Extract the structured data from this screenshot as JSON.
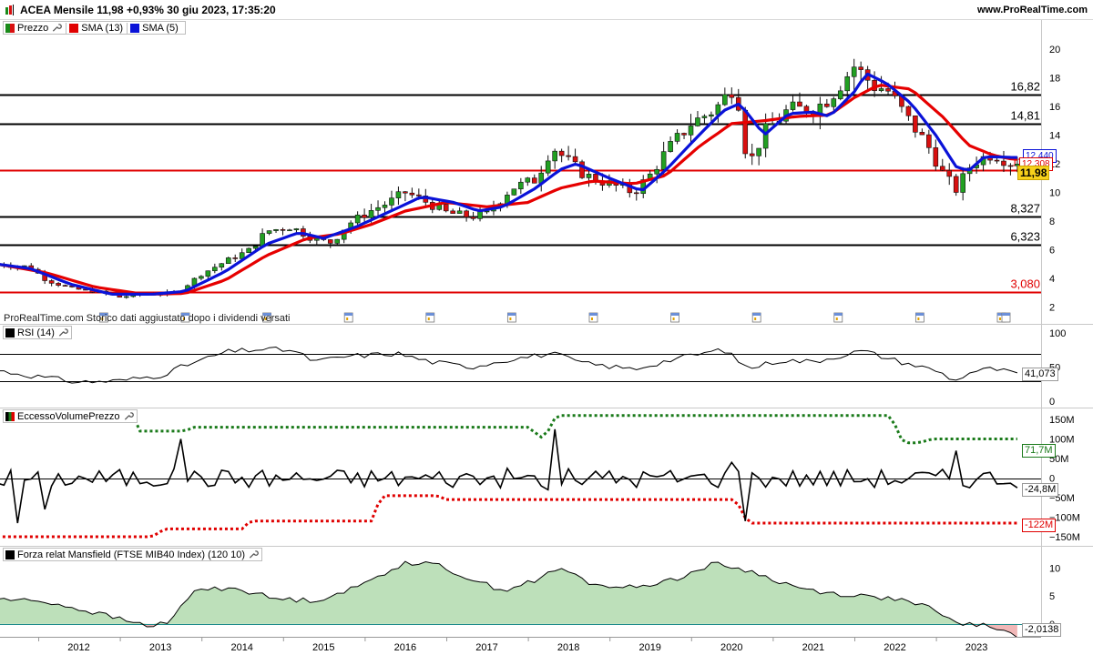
{
  "header": {
    "title": "ACEA Mensile 11,98 +0,93% 30 giu 2023, 17:35:20",
    "site": "www.ProRealTime.com"
  },
  "legend_price": [
    {
      "label": "Prezzo",
      "color": "#1a8a1a"
    },
    {
      "label": "SMA (13)",
      "color": "#e00000"
    },
    {
      "label": "SMA (5)",
      "color": "#0a12d8"
    }
  ],
  "legend_rsi": {
    "label": "RSI (14)"
  },
  "legend_volume": {
    "label": "EccessoVolumePrezzo"
  },
  "legend_mansfield": {
    "label": "Forza relat Mansfield (FTSE MIB40 Index) (120 10)"
  },
  "watermark": "ProRealTime.com  Storico dati aggiustato dopo i dividendi versati",
  "badges": {
    "price_last": "11,98",
    "sma13_last": "12,308",
    "sma5_last": "12,440",
    "rsi_last": "41,073",
    "vol_upper_last": "71,7M",
    "vol_main_last": "-24,8M",
    "vol_lower_last": "-122M",
    "mansfield_last": "-2,0138"
  },
  "colors": {
    "bull": "#22a022",
    "bear": "#d81010",
    "sma13": "#e60000",
    "sma5": "#0a12d8",
    "level_black": "#000000",
    "level_red": "#e00000",
    "vol_green": "#1a7a1a",
    "vol_red": "#e00000",
    "mansfield_fill": "#b6ddb2",
    "mansfield_neg_fill": "#f0b7b7"
  },
  "icons": {
    "logo": "prorealtime-logo-icon",
    "settings": "wrench-icon",
    "dividend": "dividend-calendar-icon"
  },
  "chart_data": [
    {
      "type": "candlestick",
      "name": "price",
      "x_axis_years": [
        "2012",
        "2013",
        "2014",
        "2015",
        "2016",
        "2017",
        "2018",
        "2019",
        "2020",
        "2021",
        "2022",
        "2023"
      ],
      "x_range": [
        2011.0,
        2023.5
      ],
      "ylim": [
        2,
        21
      ],
      "y_ticks": [
        2,
        4,
        6,
        8,
        10,
        12,
        14,
        16,
        18,
        20
      ],
      "price_anchors": [
        [
          2011.0,
          5.0
        ],
        [
          2011.4,
          4.8
        ],
        [
          2011.6,
          3.9
        ],
        [
          2011.9,
          3.3
        ],
        [
          2012.2,
          3.1
        ],
        [
          2012.5,
          2.7
        ],
        [
          2012.8,
          2.9
        ],
        [
          2013.2,
          3.0
        ],
        [
          2013.5,
          4.3
        ],
        [
          2013.8,
          5.2
        ],
        [
          2014.1,
          6.0
        ],
        [
          2014.3,
          7.3
        ],
        [
          2014.6,
          7.6
        ],
        [
          2014.9,
          6.7
        ],
        [
          2015.1,
          6.5
        ],
        [
          2015.3,
          7.8
        ],
        [
          2015.6,
          8.8
        ],
        [
          2015.8,
          9.3
        ],
        [
          2016.0,
          10.0
        ],
        [
          2016.2,
          9.5
        ],
        [
          2016.5,
          8.6
        ],
        [
          2016.8,
          8.3
        ],
        [
          2017.0,
          8.5
        ],
        [
          2017.3,
          10.3
        ],
        [
          2017.6,
          10.9
        ],
        [
          2017.8,
          13.2
        ],
        [
          2017.95,
          12.4
        ],
        [
          2018.2,
          11.2
        ],
        [
          2018.5,
          10.6
        ],
        [
          2018.8,
          10.0
        ],
        [
          2019.0,
          11.2
        ],
        [
          2019.2,
          12.9
        ],
        [
          2019.5,
          14.8
        ],
        [
          2019.8,
          15.8
        ],
        [
          2020.05,
          17.6
        ],
        [
          2020.2,
          11.8
        ],
        [
          2020.4,
          14.2
        ],
        [
          2020.7,
          15.8
        ],
        [
          2021.0,
          15.8
        ],
        [
          2021.2,
          16.6
        ],
        [
          2021.5,
          18.8
        ],
        [
          2021.75,
          17.4
        ],
        [
          2021.9,
          17.2
        ],
        [
          2022.2,
          14.8
        ],
        [
          2022.4,
          13.3
        ],
        [
          2022.6,
          11.2
        ],
        [
          2022.75,
          10.2
        ],
        [
          2022.95,
          12.1
        ],
        [
          2023.2,
          12.7
        ],
        [
          2023.45,
          11.98
        ]
      ],
      "lines": [
        {
          "name": "SMA (13)",
          "anchors": [
            [
              2011.0,
              5.0
            ],
            [
              2011.6,
              4.4
            ],
            [
              2012.2,
              3.4
            ],
            [
              2012.8,
              2.9
            ],
            [
              2013.3,
              2.95
            ],
            [
              2013.8,
              3.9
            ],
            [
              2014.3,
              5.6
            ],
            [
              2014.8,
              6.8
            ],
            [
              2015.2,
              7.1
            ],
            [
              2015.6,
              7.8
            ],
            [
              2016.0,
              8.7
            ],
            [
              2016.5,
              9.3
            ],
            [
              2017.0,
              9.0
            ],
            [
              2017.5,
              9.3
            ],
            [
              2017.9,
              10.3
            ],
            [
              2018.3,
              10.8
            ],
            [
              2018.8,
              10.6
            ],
            [
              2019.2,
              11.2
            ],
            [
              2019.6,
              13.2
            ],
            [
              2020.0,
              14.8
            ],
            [
              2020.4,
              15.0
            ],
            [
              2020.8,
              15.3
            ],
            [
              2021.2,
              15.4
            ],
            [
              2021.5,
              16.6
            ],
            [
              2021.8,
              17.5
            ],
            [
              2022.2,
              17.2
            ],
            [
              2022.6,
              15.2
            ],
            [
              2022.9,
              13.3
            ],
            [
              2023.2,
              12.6
            ],
            [
              2023.45,
              12.31
            ]
          ]
        },
        {
          "name": "SMA (5)",
          "anchors": [
            [
              2011.0,
              5.0
            ],
            [
              2011.4,
              4.7
            ],
            [
              2011.9,
              3.6
            ],
            [
              2012.4,
              2.9
            ],
            [
              2012.9,
              2.9
            ],
            [
              2013.3,
              3.1
            ],
            [
              2013.8,
              4.5
            ],
            [
              2014.3,
              6.4
            ],
            [
              2014.7,
              7.2
            ],
            [
              2015.0,
              6.8
            ],
            [
              2015.4,
              7.6
            ],
            [
              2015.9,
              8.9
            ],
            [
              2016.2,
              9.7
            ],
            [
              2016.6,
              9.3
            ],
            [
              2016.9,
              8.7
            ],
            [
              2017.2,
              9.0
            ],
            [
              2017.6,
              10.3
            ],
            [
              2017.9,
              11.6
            ],
            [
              2018.1,
              12.0
            ],
            [
              2018.5,
              11.0
            ],
            [
              2018.9,
              10.1
            ],
            [
              2019.2,
              11.6
            ],
            [
              2019.6,
              14.0
            ],
            [
              2019.9,
              15.7
            ],
            [
              2020.1,
              16.2
            ],
            [
              2020.4,
              14.0
            ],
            [
              2020.7,
              15.5
            ],
            [
              2021.0,
              15.6
            ],
            [
              2021.2,
              15.3
            ],
            [
              2021.5,
              17.0
            ],
            [
              2021.65,
              18.3
            ],
            [
              2021.9,
              17.6
            ],
            [
              2022.2,
              16.2
            ],
            [
              2022.5,
              14.0
            ],
            [
              2022.75,
              11.8
            ],
            [
              2022.9,
              11.5
            ],
            [
              2023.1,
              12.5
            ],
            [
              2023.45,
              12.44
            ]
          ]
        }
      ],
      "levels": [
        {
          "value": 16.82,
          "label": "16,82",
          "color": "black"
        },
        {
          "value": 14.81,
          "label": "14,81",
          "color": "black"
        },
        {
          "value": 11.57,
          "label": "11,57",
          "color": "red"
        },
        {
          "value": 8.327,
          "label": "8,327",
          "color": "black"
        },
        {
          "value": 6.323,
          "label": "6,323",
          "color": "black"
        },
        {
          "value": 3.08,
          "label": "3,080",
          "color": "red"
        }
      ]
    },
    {
      "type": "line",
      "name": "RSI (14)",
      "ylim": [
        0,
        100
      ],
      "y_ticks": [
        0,
        50,
        100
      ],
      "bands": [
        30,
        70
      ],
      "anchors": [
        [
          2011.0,
          45
        ],
        [
          2011.5,
          36
        ],
        [
          2012.0,
          28
        ],
        [
          2012.5,
          30
        ],
        [
          2013.0,
          38
        ],
        [
          2013.3,
          52
        ],
        [
          2013.8,
          72
        ],
        [
          2014.2,
          76
        ],
        [
          2014.6,
          75
        ],
        [
          2014.9,
          58
        ],
        [
          2015.3,
          66
        ],
        [
          2015.9,
          70
        ],
        [
          2016.3,
          58
        ],
        [
          2016.8,
          50
        ],
        [
          2017.2,
          60
        ],
        [
          2017.8,
          70
        ],
        [
          2018.2,
          55
        ],
        [
          2018.8,
          47
        ],
        [
          2019.3,
          62
        ],
        [
          2019.9,
          76
        ],
        [
          2020.2,
          48
        ],
        [
          2020.6,
          60
        ],
        [
          2021.0,
          58
        ],
        [
          2021.6,
          74
        ],
        [
          2022.0,
          60
        ],
        [
          2022.5,
          45
        ],
        [
          2022.75,
          30
        ],
        [
          2022.9,
          42
        ],
        [
          2023.2,
          48
        ],
        [
          2023.45,
          41
        ]
      ]
    },
    {
      "type": "line",
      "name": "EccessoVolumePrezzo",
      "ylim": [
        -150,
        150
      ],
      "y_ticks": [
        150,
        100,
        50,
        0,
        -50,
        -100,
        -150
      ],
      "y_tick_labels": [
        "150M",
        "100M",
        "50M",
        "0",
        "-50M",
        "-100M",
        "-150M"
      ],
      "upper_band_steps": [
        [
          2011.0,
          190
        ],
        [
          2012.6,
          190
        ],
        [
          2012.75,
          120
        ],
        [
          2013.3,
          120
        ],
        [
          2013.4,
          130
        ],
        [
          2017.5,
          130
        ],
        [
          2017.7,
          100
        ],
        [
          2017.85,
          160
        ],
        [
          2021.95,
          160
        ],
        [
          2022.1,
          90
        ],
        [
          2022.3,
          90
        ],
        [
          2022.45,
          100
        ],
        [
          2023.45,
          100
        ]
      ],
      "lower_band_steps": [
        [
          2011.0,
          -150
        ],
        [
          2012.9,
          -150
        ],
        [
          2013.05,
          -130
        ],
        [
          2014.0,
          -130
        ],
        [
          2014.1,
          -110
        ],
        [
          2015.6,
          -110
        ],
        [
          2015.7,
          -45
        ],
        [
          2016.4,
          -45
        ],
        [
          2016.5,
          -55
        ],
        [
          2020.05,
          -55
        ],
        [
          2020.2,
          -115
        ],
        [
          2023.45,
          -115
        ]
      ]
    },
    {
      "type": "area",
      "name": "Forza relat Mansfield (FTSE MIB40 Index) (120 10)",
      "ylim": [
        -2.5,
        12
      ],
      "y_ticks": [
        10,
        5,
        0
      ],
      "anchors": [
        [
          2011.0,
          4.5
        ],
        [
          2011.6,
          4.0
        ],
        [
          2012.2,
          2.0
        ],
        [
          2012.8,
          -0.2
        ],
        [
          2013.1,
          0.0
        ],
        [
          2013.4,
          6.0
        ],
        [
          2013.9,
          6.5
        ],
        [
          2014.4,
          4.5
        ],
        [
          2014.9,
          4.2
        ],
        [
          2015.4,
          6.5
        ],
        [
          2015.8,
          9.5
        ],
        [
          2016.0,
          11.0
        ],
        [
          2016.4,
          10.5
        ],
        [
          2016.8,
          8.0
        ],
        [
          2017.2,
          6.0
        ],
        [
          2017.6,
          7.8
        ],
        [
          2017.9,
          10.0
        ],
        [
          2018.3,
          7.0
        ],
        [
          2018.8,
          6.5
        ],
        [
          2019.3,
          8.0
        ],
        [
          2019.8,
          10.8
        ],
        [
          2020.2,
          9.5
        ],
        [
          2020.8,
          6.5
        ],
        [
          2021.2,
          5.5
        ],
        [
          2021.6,
          5.0
        ],
        [
          2022.0,
          4.5
        ],
        [
          2022.4,
          3.0
        ],
        [
          2022.7,
          0.5
        ],
        [
          2022.9,
          0.0
        ],
        [
          2023.2,
          -0.5
        ],
        [
          2023.45,
          -2.01
        ]
      ]
    }
  ]
}
